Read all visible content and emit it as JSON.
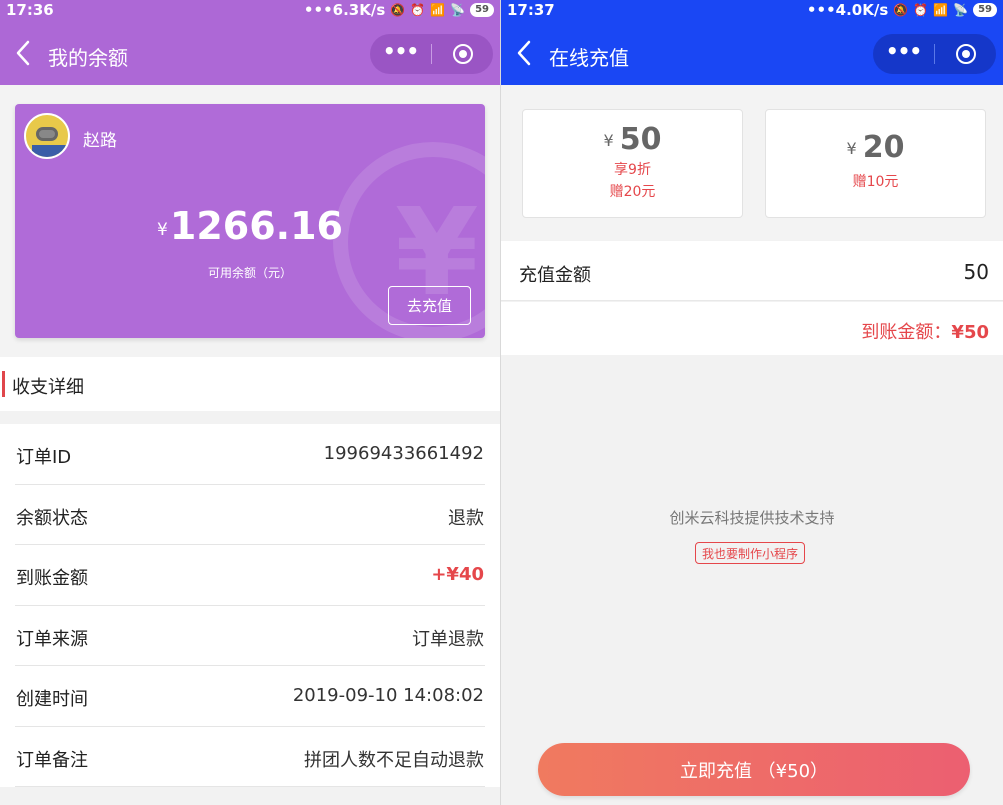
{
  "left": {
    "status": {
      "time": "17:36",
      "speed": "6.3K/s",
      "battery": "59"
    },
    "nav": {
      "title": "我的余额"
    },
    "card": {
      "username": "赵路",
      "currency": "¥",
      "balance": "1266.16",
      "balance_label": "可用余额（元）",
      "recharge_button": "去充值"
    },
    "section_title": "收支详细",
    "details": [
      {
        "key": "订单ID",
        "value": "19969433661492"
      },
      {
        "key": "余额状态",
        "value": "退款"
      },
      {
        "key": "到账金额",
        "value": "+¥40"
      },
      {
        "key": "订单来源",
        "value": "订单退款"
      },
      {
        "key": "创建时间",
        "value": "2019-09-10 14:08:02"
      },
      {
        "key": "订单备注",
        "value": "拼团人数不足自动退款"
      }
    ]
  },
  "right": {
    "status": {
      "time": "17:37",
      "speed": "4.0K/s",
      "battery": "59"
    },
    "nav": {
      "title": "在线充值"
    },
    "packages": [
      {
        "currency": "¥",
        "amount": "50",
        "discount": "享9折",
        "bonus": "赠20元"
      },
      {
        "currency": "¥",
        "amount": "20",
        "bonus": "赠10元"
      }
    ],
    "amount_label": "充值金额",
    "amount_value": "50",
    "credit_label": "到账金额：",
    "credit_value": "¥50",
    "support_text": "创米云科技提供技术支持",
    "mini_program_tag": "我也要制作小程序",
    "pay_button": "立即充值 （¥50）"
  },
  "colors": {
    "left_theme": "#ad68d6",
    "right_theme": "#1a47f4",
    "accent_red": "#e5474b"
  }
}
